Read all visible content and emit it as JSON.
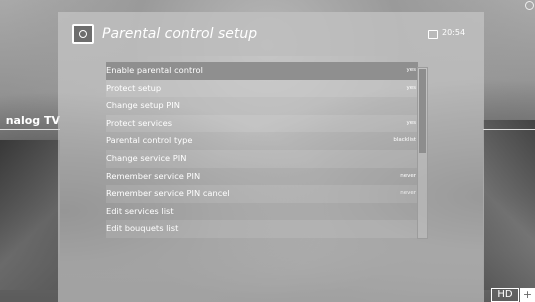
{
  "background": {
    "side_label": "nalog TV"
  },
  "header": {
    "title": "Parental control setup",
    "clock_icon": "clock-icon",
    "time": "20:54"
  },
  "menu": {
    "items": [
      {
        "label": "Enable parental control",
        "value": "yes"
      },
      {
        "label": "Protect setup",
        "value": "yes"
      },
      {
        "label": "Change setup PIN",
        "value": ""
      },
      {
        "label": "Protect services",
        "value": "yes"
      },
      {
        "label": "Parental control type",
        "value": "blacklist"
      },
      {
        "label": "Change service PIN",
        "value": ""
      },
      {
        "label": "Remember service PIN",
        "value": "never"
      },
      {
        "label": "Remember service PIN cancel",
        "value": "never"
      },
      {
        "label": "Edit services list",
        "value": ""
      },
      {
        "label": "Edit bouquets list",
        "value": ""
      }
    ],
    "selected_index": 0,
    "scroll_fraction_visible": 0.49
  },
  "badges": {
    "hd": "HD",
    "plus": "+"
  }
}
